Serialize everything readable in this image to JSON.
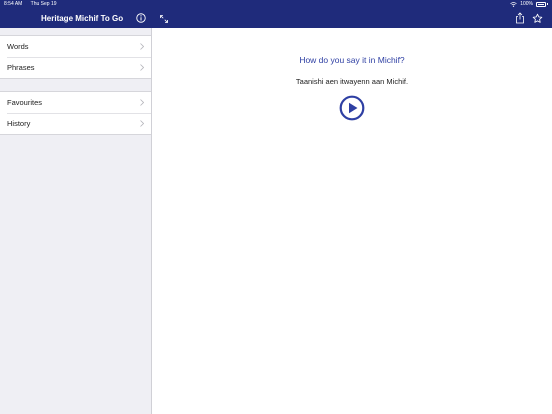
{
  "status_bar": {
    "time": "8:54 AM",
    "date": "Thu Sep 19",
    "battery": "100%"
  },
  "app": {
    "title": "Heritage Michif To Go"
  },
  "sidebar": {
    "groups": [
      {
        "items": [
          {
            "label": "Words"
          },
          {
            "label": "Phrases"
          }
        ]
      },
      {
        "items": [
          {
            "label": "Favourites"
          },
          {
            "label": "History"
          }
        ]
      }
    ]
  },
  "content": {
    "question": "How do you say it in Michif?",
    "answer": "Taanishi aen itwayenn aan Michif."
  },
  "colors": {
    "nav": "#1f2b7b",
    "accent": "#2e3fa3"
  },
  "icons": [
    "info-icon",
    "expand-icon",
    "share-icon",
    "star-icon",
    "chevron-right-icon",
    "play-icon",
    "wifi-icon",
    "battery-icon"
  ]
}
